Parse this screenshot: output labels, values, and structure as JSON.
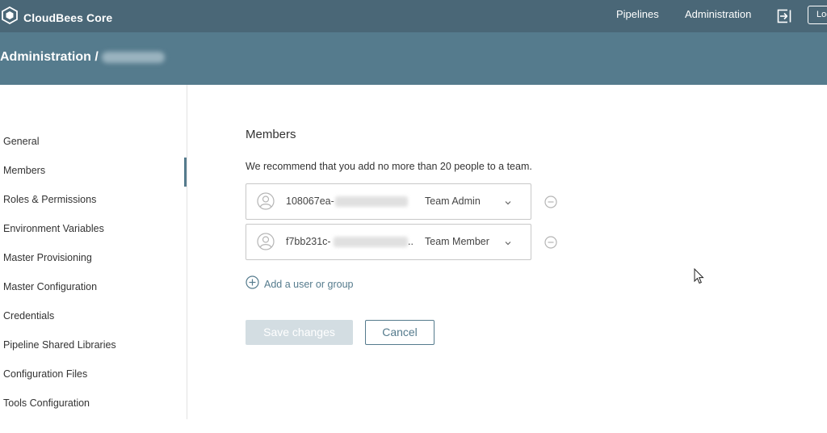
{
  "colors": {
    "topbar": "#4a6777",
    "subheader": "#557b8d",
    "accent": "#557b8d",
    "save_disabled": "#d3dde2"
  },
  "topbar": {
    "logo_icon": "cloudbees-hexagon-icon",
    "brand": "CloudBees Core",
    "nav": {
      "pipelines": "Pipelines",
      "administration": "Administration"
    },
    "exit_icon": "sign-out-icon",
    "login_label": "Log"
  },
  "subheader": {
    "breadcrumb": "Administration /"
  },
  "sidebar": {
    "items": [
      {
        "label": "General"
      },
      {
        "label": "Members"
      },
      {
        "label": "Roles & Permissions"
      },
      {
        "label": "Environment Variables"
      },
      {
        "label": "Master Provisioning"
      },
      {
        "label": "Master Configuration"
      },
      {
        "label": "Credentials"
      },
      {
        "label": "Pipeline Shared Libraries"
      },
      {
        "label": "Configuration Files"
      },
      {
        "label": "Tools Configuration"
      }
    ],
    "active": "Members"
  },
  "main": {
    "title": "Members",
    "description": "We recommend that you add no more than 20 people to a team.",
    "members": [
      {
        "id": "108067ea-",
        "truncation": "",
        "role": "Team Admin"
      },
      {
        "id": "f7bb231c-",
        "truncation": "..",
        "role": "Team Member"
      }
    ],
    "add_label": "Add a user or group",
    "save_label": "Save changes",
    "cancel_label": "Cancel"
  }
}
